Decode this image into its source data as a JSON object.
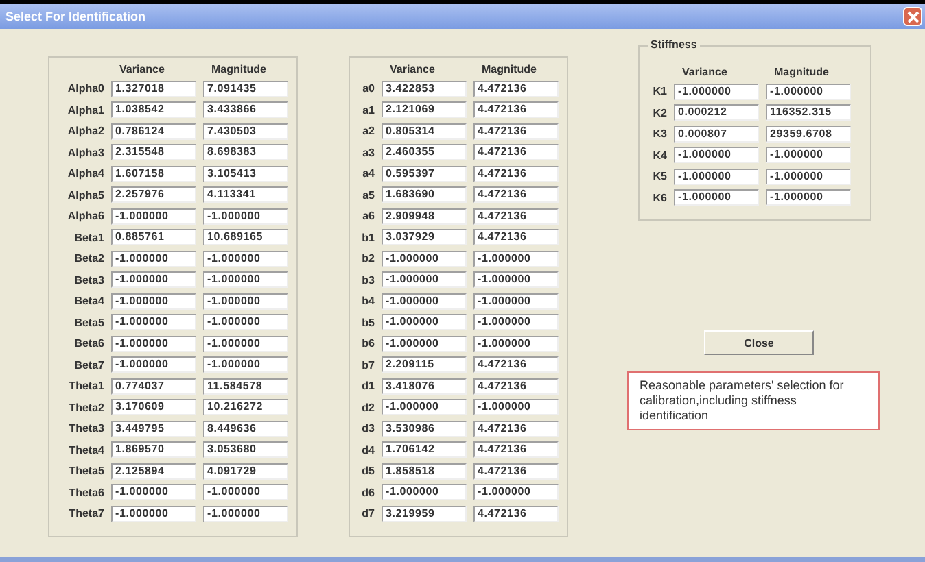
{
  "window": {
    "title": "Select For Identification"
  },
  "groups": [
    {
      "columns": [
        "Variance",
        "Magnitude"
      ],
      "rows": [
        {
          "label": "Alpha0",
          "variance": "1.327018",
          "magnitude": "7.091435"
        },
        {
          "label": "Alpha1",
          "variance": "1.038542",
          "magnitude": "3.433866"
        },
        {
          "label": "Alpha2",
          "variance": "0.786124",
          "magnitude": "7.430503"
        },
        {
          "label": "Alpha3",
          "variance": "2.315548",
          "magnitude": "8.698383"
        },
        {
          "label": "Alpha4",
          "variance": "1.607158",
          "magnitude": "3.105413"
        },
        {
          "label": "Alpha5",
          "variance": "2.257976",
          "magnitude": "4.113341"
        },
        {
          "label": "Alpha6",
          "variance": "-1.000000",
          "magnitude": "-1.000000"
        },
        {
          "label": "Beta1",
          "variance": "0.885761",
          "magnitude": "10.689165"
        },
        {
          "label": "Beta2",
          "variance": "-1.000000",
          "magnitude": "-1.000000"
        },
        {
          "label": "Beta3",
          "variance": "-1.000000",
          "magnitude": "-1.000000"
        },
        {
          "label": "Beta4",
          "variance": "-1.000000",
          "magnitude": "-1.000000"
        },
        {
          "label": "Beta5",
          "variance": "-1.000000",
          "magnitude": "-1.000000"
        },
        {
          "label": "Beta6",
          "variance": "-1.000000",
          "magnitude": "-1.000000"
        },
        {
          "label": "Beta7",
          "variance": "-1.000000",
          "magnitude": "-1.000000"
        },
        {
          "label": "Theta1",
          "variance": "0.774037",
          "magnitude": "11.584578"
        },
        {
          "label": "Theta2",
          "variance": "3.170609",
          "magnitude": "10.216272"
        },
        {
          "label": "Theta3",
          "variance": "3.449795",
          "magnitude": "8.449636"
        },
        {
          "label": "Theta4",
          "variance": "1.869570",
          "magnitude": "3.053680"
        },
        {
          "label": "Theta5",
          "variance": "2.125894",
          "magnitude": "4.091729"
        },
        {
          "label": "Theta6",
          "variance": "-1.000000",
          "magnitude": "-1.000000"
        },
        {
          "label": "Theta7",
          "variance": "-1.000000",
          "magnitude": "-1.000000"
        }
      ]
    },
    {
      "columns": [
        "Variance",
        "Magnitude"
      ],
      "rows": [
        {
          "label": "a0",
          "variance": "3.422853",
          "magnitude": "4.472136"
        },
        {
          "label": "a1",
          "variance": "2.121069",
          "magnitude": "4.472136"
        },
        {
          "label": "a2",
          "variance": "0.805314",
          "magnitude": "4.472136"
        },
        {
          "label": "a3",
          "variance": "2.460355",
          "magnitude": "4.472136"
        },
        {
          "label": "a4",
          "variance": "0.595397",
          "magnitude": "4.472136"
        },
        {
          "label": "a5",
          "variance": "1.683690",
          "magnitude": "4.472136"
        },
        {
          "label": "a6",
          "variance": "2.909948",
          "magnitude": "4.472136"
        },
        {
          "label": "b1",
          "variance": "3.037929",
          "magnitude": "4.472136"
        },
        {
          "label": "b2",
          "variance": "-1.000000",
          "magnitude": "-1.000000"
        },
        {
          "label": "b3",
          "variance": "-1.000000",
          "magnitude": "-1.000000"
        },
        {
          "label": "b4",
          "variance": "-1.000000",
          "magnitude": "-1.000000"
        },
        {
          "label": "b5",
          "variance": "-1.000000",
          "magnitude": "-1.000000"
        },
        {
          "label": "b6",
          "variance": "-1.000000",
          "magnitude": "-1.000000"
        },
        {
          "label": "b7",
          "variance": "2.209115",
          "magnitude": "4.472136"
        },
        {
          "label": "d1",
          "variance": "3.418076",
          "magnitude": "4.472136"
        },
        {
          "label": "d2",
          "variance": "-1.000000",
          "magnitude": "-1.000000"
        },
        {
          "label": "d3",
          "variance": "3.530986",
          "magnitude": "4.472136"
        },
        {
          "label": "d4",
          "variance": "1.706142",
          "magnitude": "4.472136"
        },
        {
          "label": "d5",
          "variance": "1.858518",
          "magnitude": "4.472136"
        },
        {
          "label": "d6",
          "variance": "-1.000000",
          "magnitude": "-1.000000"
        },
        {
          "label": "d7",
          "variance": "3.219959",
          "magnitude": "4.472136"
        }
      ]
    }
  ],
  "stiffness": {
    "title": "Stiffness",
    "columns": [
      "Variance",
      "Magnitude"
    ],
    "rows": [
      {
        "label": "K1",
        "variance": "-1.000000",
        "magnitude": "-1.000000"
      },
      {
        "label": "K2",
        "variance": "0.000212",
        "magnitude": "116352.315"
      },
      {
        "label": "K3",
        "variance": "0.000807",
        "magnitude": "29359.6708"
      },
      {
        "label": "K4",
        "variance": "-1.000000",
        "magnitude": "-1.000000"
      },
      {
        "label": "K5",
        "variance": "-1.000000",
        "magnitude": "-1.000000"
      },
      {
        "label": "K6",
        "variance": "-1.000000",
        "magnitude": "-1.000000"
      }
    ]
  },
  "close_button": "Close",
  "note": "Reasonable parameters' selection for calibration,including stiffness identification"
}
